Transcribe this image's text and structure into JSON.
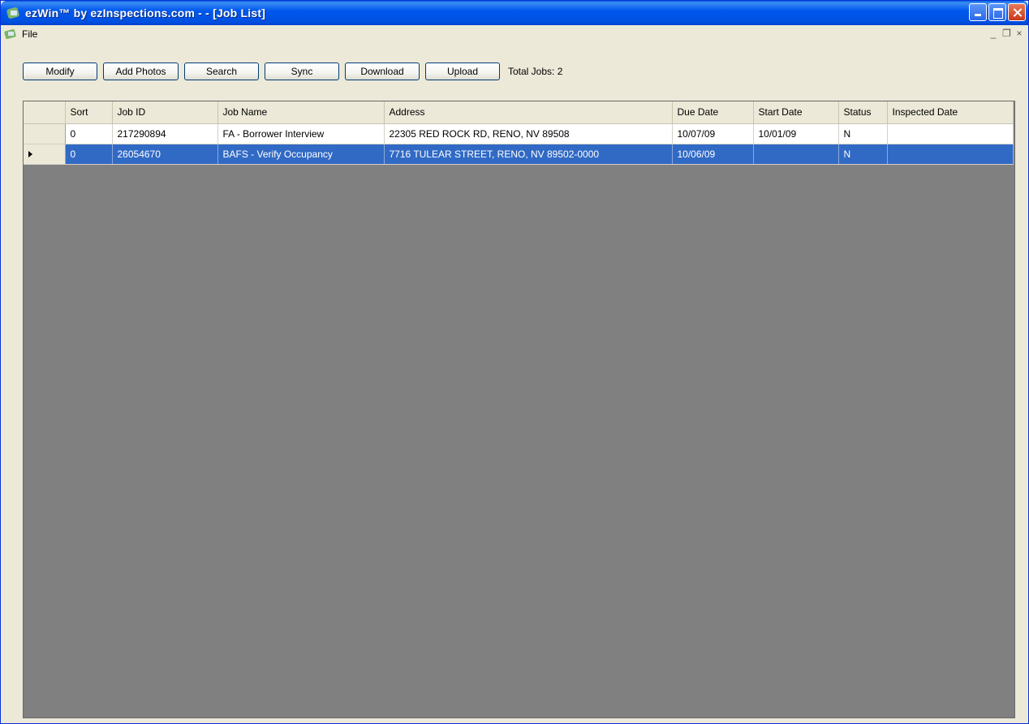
{
  "window": {
    "title": "ezWin™ by ezInspections.com - - [Job List]"
  },
  "menu": {
    "file_label": "File",
    "mdi_minimize": "_",
    "mdi_restore": "❐",
    "mdi_close": "×"
  },
  "toolbar": {
    "modify_label": "Modify",
    "add_photos_label": "Add Photos",
    "search_label": "Search",
    "sync_label": "Sync",
    "download_label": "Download",
    "upload_label": "Upload",
    "total_jobs_text": "Total Jobs: 2"
  },
  "grid": {
    "columns": [
      "Sort",
      "Job ID",
      "Job Name",
      "Address",
      "Due Date",
      "Start Date",
      "Status",
      "Inspected Date"
    ],
    "rows": [
      {
        "sort": "0",
        "job_id": "217290894",
        "job_name": "FA - Borrower Interview",
        "address": "22305 RED ROCK RD, RENO, NV 89508",
        "due_date": "10/07/09",
        "start_date": "10/01/09",
        "status": "N",
        "inspected_date": ""
      },
      {
        "sort": "0",
        "job_id": "26054670",
        "job_name": "BAFS - Verify Occupancy",
        "address": "7716 TULEAR STREET, RENO, NV 89502-0000",
        "due_date": "10/06/09",
        "start_date": "",
        "status": "N",
        "inspected_date": ""
      }
    ]
  },
  "colors": {
    "selection": "#316ac5",
    "grid_background": "#808080",
    "titlebar": "#0058ee"
  }
}
